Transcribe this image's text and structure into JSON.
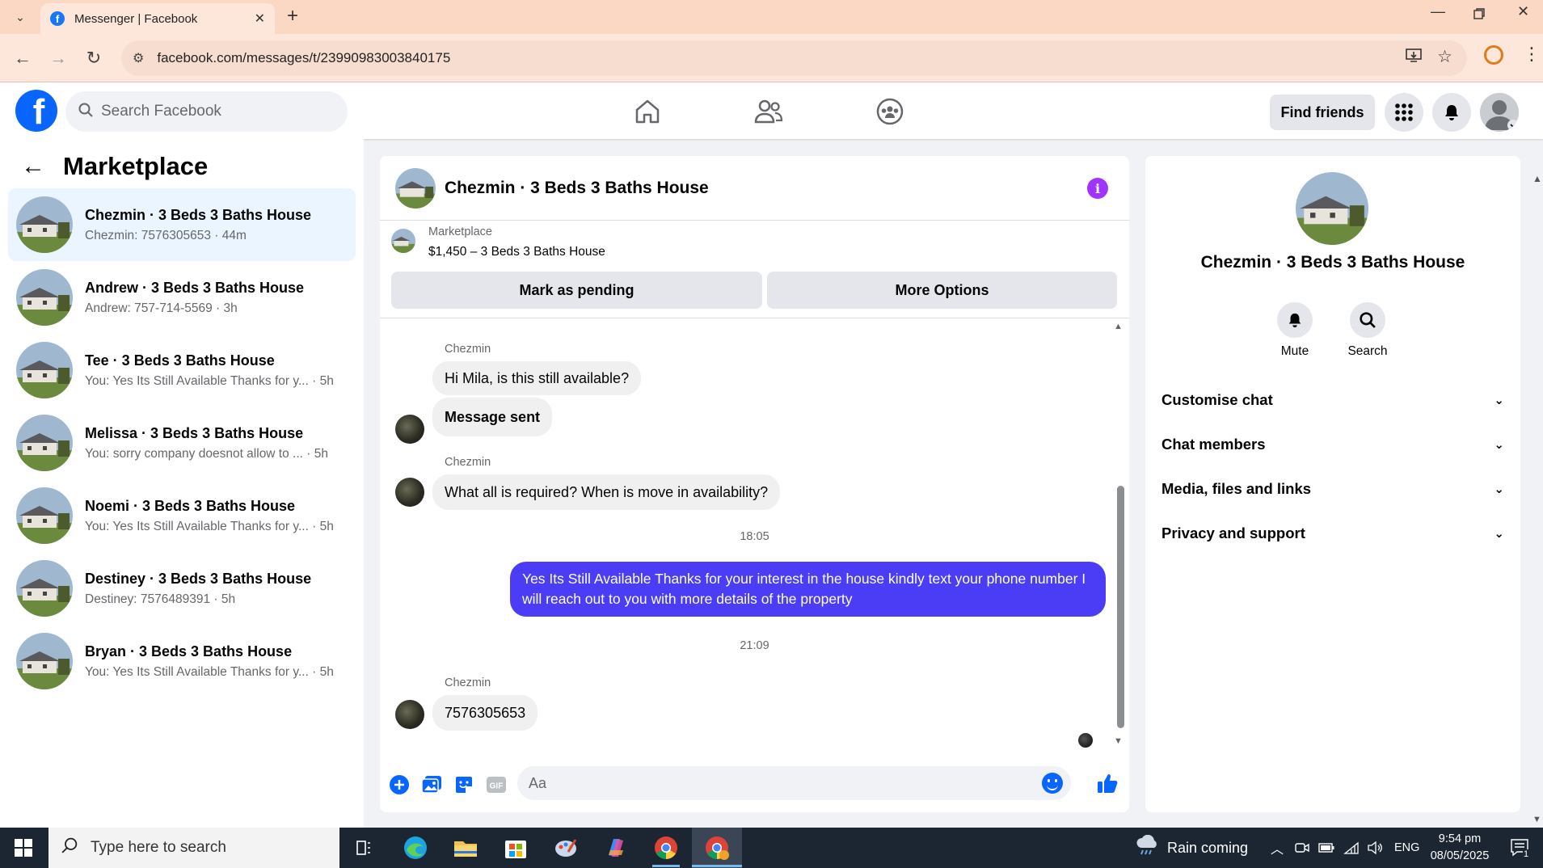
{
  "browser": {
    "tab_title": "Messenger | Facebook",
    "url": "facebook.com/messages/t/23990983003840175"
  },
  "fb": {
    "search_placeholder": "Search Facebook",
    "find_friends": "Find friends"
  },
  "left": {
    "title": "Marketplace",
    "conversations": [
      {
        "name": "Chezmin · 3 Beds 3 Baths House",
        "preview": "Chezmin: 7576305653 · 44m",
        "active": true
      },
      {
        "name": "Andrew · 3 Beds 3 Baths House",
        "preview": "Andrew: 757-714-5569 · 3h"
      },
      {
        "name": "Tee · 3 Beds 3 Baths House",
        "preview": "You: Yes Its Still Available Thanks for y... · 5h"
      },
      {
        "name": "Melissa · 3 Beds 3 Baths House",
        "preview": "You: sorry company doesnot allow to ... · 5h"
      },
      {
        "name": "Noemi · 3 Beds 3 Baths House",
        "preview": "You: Yes Its Still Available Thanks for y... · 5h"
      },
      {
        "name": "Destiney · 3 Beds 3 Baths House",
        "preview": "Destiney: 7576489391 · 5h"
      },
      {
        "name": "Bryan · 3 Beds 3 Baths House",
        "preview": "You: Yes Its Still Available Thanks for y... · 5h"
      }
    ]
  },
  "chat": {
    "title": "Chezmin · 3 Beds 3 Baths House",
    "listing_source": "Marketplace",
    "listing": "$1,450 – 3 Beds 3 Baths House",
    "mark_pending": "Mark as pending",
    "more_options": "More Options",
    "sender": "Chezmin",
    "msg1": "Hi Mila, is this still available?",
    "msg2": "Message sent",
    "msg3": "What all is required? When is move in availability?",
    "time1": "18:05",
    "my_msg": "Yes Its Still Available Thanks for your interest in the house kindly text your phone number I will reach out to you with more details of the property",
    "time2": "21:09",
    "msg4": "7576305653",
    "composer_placeholder": "Aa"
  },
  "details": {
    "name": "Chezmin · 3 Beds 3 Baths House",
    "mute": "Mute",
    "search": "Search",
    "sections": [
      "Customise chat",
      "Chat members",
      "Media, files and links",
      "Privacy and support"
    ]
  },
  "taskbar": {
    "search_placeholder": "Type here to search",
    "weather": "Rain coming",
    "lang": "ENG",
    "time": "9:54 pm",
    "date": "08/05/2025",
    "notif_count": "1"
  },
  "colors": {
    "fb_blue": "#0866ff",
    "my_bubble": "#4a3df5",
    "info_purple": "#a033ff"
  }
}
